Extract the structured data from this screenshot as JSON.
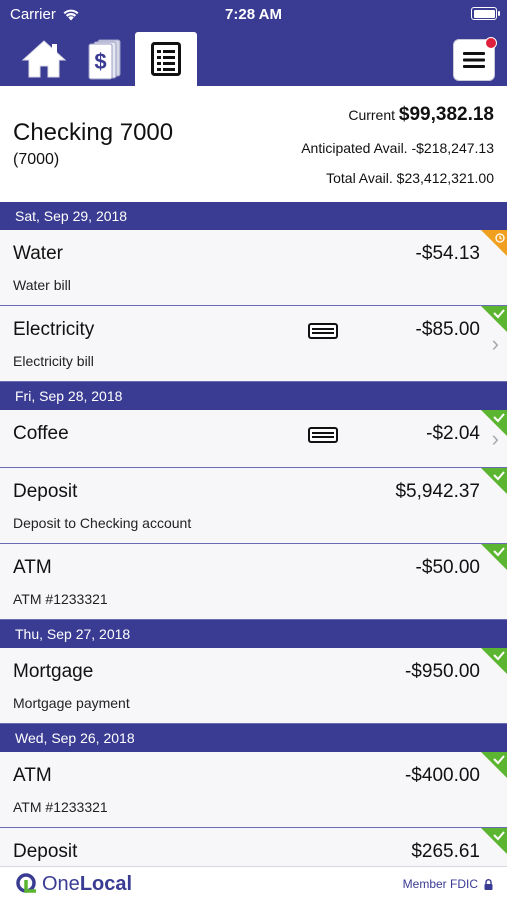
{
  "status_bar": {
    "carrier": "Carrier",
    "time": "7:28 AM"
  },
  "nav": {
    "tabs": [
      {
        "icon": "home-icon",
        "active": false
      },
      {
        "icon": "money-icon",
        "active": false
      },
      {
        "icon": "register-icon",
        "active": true
      }
    ],
    "menu_icon": "hamburger-menu-icon",
    "notification_color": "#e0213d"
  },
  "account": {
    "name": "Checking 7000",
    "number": "(7000)",
    "current_label": "Current",
    "current_value": "$99,382.18",
    "anticipated_label": "Anticipated Avail.",
    "anticipated_value": "-$218,247.13",
    "total_label": "Total Avail.",
    "total_value": "$23,412,321.00"
  },
  "groups": [
    {
      "date": "Sat, Sep 29, 2018",
      "transactions": [
        {
          "name": "Water",
          "description": "Water bill",
          "amount": "-$54.13",
          "status": "pending"
        },
        {
          "name": "Electricity",
          "description": "Electricity bill",
          "amount": "-$85.00",
          "status": "cleared",
          "card": true,
          "chevron": true
        }
      ]
    },
    {
      "date": "Fri, Sep 28, 2018",
      "transactions": [
        {
          "name": "Coffee",
          "description": "",
          "amount": "-$2.04",
          "status": "cleared",
          "card": true,
          "chevron": true
        },
        {
          "name": "Deposit",
          "description": "Deposit to Checking account",
          "amount": "$5,942.37",
          "status": "cleared"
        },
        {
          "name": "ATM",
          "description": "ATM #1233321",
          "amount": "-$50.00",
          "status": "cleared"
        }
      ]
    },
    {
      "date": "Thu, Sep 27, 2018",
      "transactions": [
        {
          "name": "Mortgage",
          "description": "Mortgage payment",
          "amount": "-$950.00",
          "status": "cleared"
        }
      ]
    },
    {
      "date": "Wed, Sep 26, 2018",
      "transactions": [
        {
          "name": "ATM",
          "description": "ATM #1233321",
          "amount": "-$400.00",
          "status": "cleared"
        },
        {
          "name": "Deposit",
          "description": "",
          "amount": "$265.61",
          "status": "cleared"
        }
      ]
    }
  ],
  "footer": {
    "logo_light": "One",
    "logo_bold": "Local",
    "fdic": "Member FDIC"
  },
  "colors": {
    "brand": "#3a3c93",
    "cleared": "#5cb531",
    "pending": "#f0a01e"
  }
}
